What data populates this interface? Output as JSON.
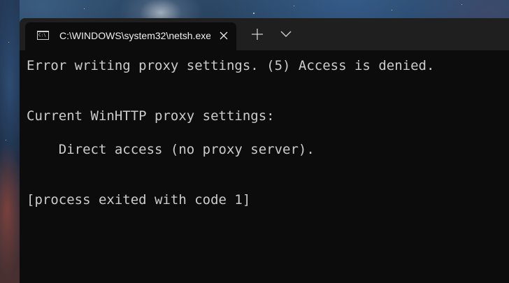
{
  "tab": {
    "icon_text": "C:\\",
    "title": "C:\\WINDOWS\\system32\\netsh.exe"
  },
  "console": {
    "lines": [
      "Error writing proxy settings. (5) Access is denied.",
      "Current WinHTTP proxy settings:",
      "    Direct access (no proxy server).",
      "[process exited with code 1]"
    ]
  },
  "colors": {
    "terminal_background": "#0c0c0c",
    "titlebar_background": "#1f1f1f",
    "terminal_text": "#cccccc"
  },
  "icons": {
    "tab": "console-icon",
    "close": "close-icon",
    "new_tab": "plus-icon",
    "dropdown": "chevron-down-icon"
  }
}
